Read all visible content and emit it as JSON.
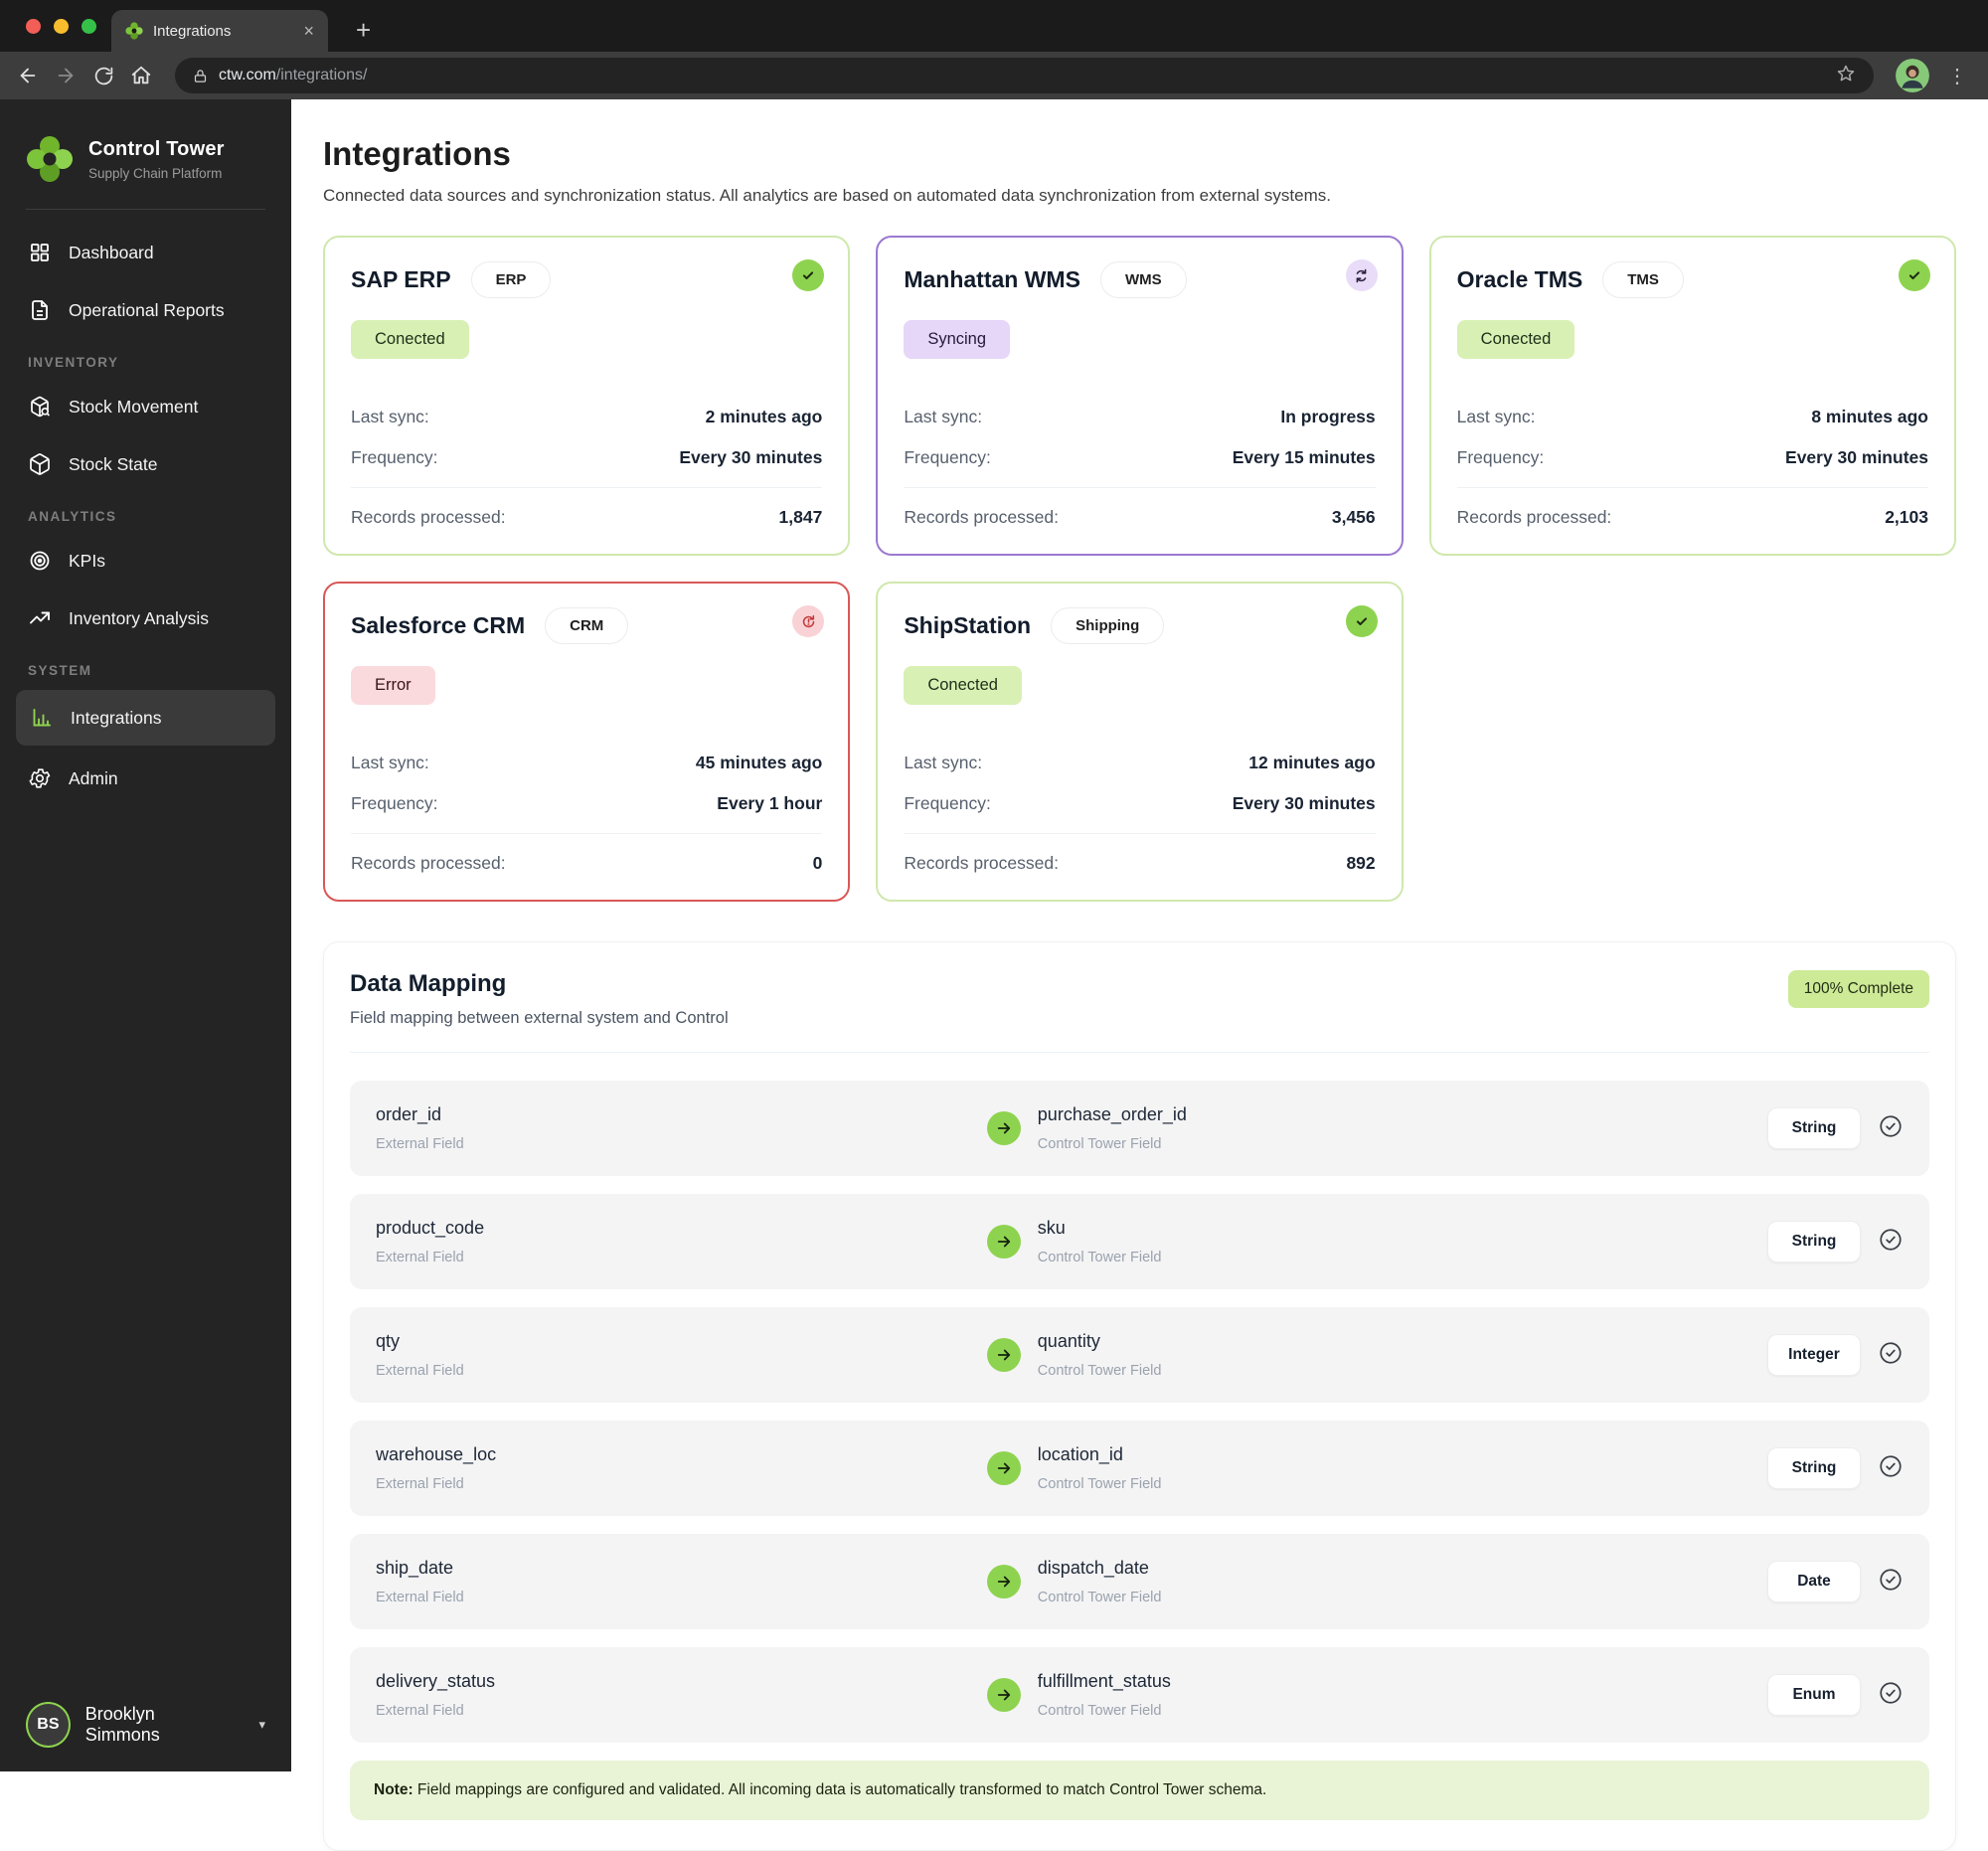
{
  "browser": {
    "tab_title": "Integrations",
    "url_domain": "ctw.com",
    "url_path": "/integrations/"
  },
  "icons": {
    "close": "×",
    "new_tab": "+",
    "more": "⋮",
    "caret_down": "▾"
  },
  "sidebar": {
    "brand_name": "Control Tower",
    "brand_tagline": "Supply Chain Platform",
    "sections": {
      "inventory": "INVENTORY",
      "analytics": "ANALYTICS",
      "system": "SYSTEM"
    },
    "items": [
      {
        "label": "Dashboard"
      },
      {
        "label": "Operational Reports"
      },
      {
        "label": "Stock Movement"
      },
      {
        "label": "Stock State"
      },
      {
        "label": "KPIs"
      },
      {
        "label": "Inventory Analysis"
      },
      {
        "label": "Integrations"
      },
      {
        "label": "Admin"
      }
    ],
    "user": {
      "initials": "BS",
      "name": "Brooklyn Simmons"
    }
  },
  "header": {
    "title": "Integrations",
    "subtitle": "Connected data sources and synchronization status. All analytics are based on automated data synchronization from external systems."
  },
  "card_labels": {
    "last_sync": "Last sync:",
    "frequency": "Frequency:",
    "records": "Records processed:"
  },
  "integrations": [
    {
      "name": "SAP ERP",
      "type": "ERP",
      "status": "Conected",
      "last_sync": "2 minutes ago",
      "frequency": "Every 30 minutes",
      "records": "1,847"
    },
    {
      "name": "Manhattan WMS",
      "type": "WMS",
      "status": "Syncing",
      "last_sync": "In progress",
      "frequency": "Every 15 minutes",
      "records": "3,456"
    },
    {
      "name": "Oracle TMS",
      "type": "TMS",
      "status": "Conected",
      "last_sync": "8 minutes ago",
      "frequency": "Every 30 minutes",
      "records": "2,103"
    },
    {
      "name": "Salesforce CRM",
      "type": "CRM",
      "status": "Error",
      "last_sync": "45 minutes ago",
      "frequency": "Every 1 hour",
      "records": "0"
    },
    {
      "name": "ShipStation",
      "type": "Shipping",
      "status": "Conected",
      "last_sync": "12 minutes ago",
      "frequency": "Every 30 minutes",
      "records": "892"
    }
  ],
  "data_mapping": {
    "title": "Data Mapping",
    "subtitle": "Field mapping between external system and Control",
    "badge": "100% Complete",
    "external_label": "External Field",
    "control_label": "Control Tower Field",
    "rows": [
      {
        "external": "order_id",
        "control": "purchase_order_id",
        "type": "String"
      },
      {
        "external": "product_code",
        "control": "sku",
        "type": "String"
      },
      {
        "external": "qty",
        "control": "quantity",
        "type": "Integer"
      },
      {
        "external": "warehouse_loc",
        "control": "location_id",
        "type": "String"
      },
      {
        "external": "ship_date",
        "control": "dispatch_date",
        "type": "Date"
      },
      {
        "external": "delivery_status",
        "control": "fulfillment_status",
        "type": "Enum"
      }
    ],
    "note_label": "Note:",
    "note_text": "Field mappings are configured and validated. All incoming data is automatically transformed to match Control Tower schema."
  },
  "colors": {
    "accent_green": "#8ed34f",
    "status_connected_bg": "#d8f0b4",
    "status_syncing_bg": "#e6d6f8",
    "status_error_bg": "#fbdade",
    "border_connected": "#cfe8ad",
    "border_syncing": "#9b79d1",
    "border_error": "#d95858",
    "note_bg": "#e9f4d7"
  }
}
